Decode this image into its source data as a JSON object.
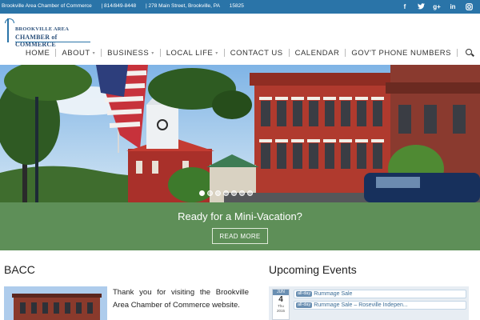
{
  "topbar": {
    "org": "Brookville Area Chamber of Commerce",
    "phone": "| 814/849-8448",
    "address": "| 278 Main Street, Brookville, PA",
    "zip": "15825",
    "social": [
      "facebook-icon",
      "twitter-icon",
      "google-plus-icon",
      "linkedin-icon",
      "instagram-icon"
    ]
  },
  "logo": {
    "line1": "BROOKVILLE AREA",
    "line2": "CHAMBER of COMMERCE"
  },
  "nav": {
    "items": [
      {
        "label": "HOME"
      },
      {
        "label": "ABOUT"
      },
      {
        "label": "BUSINESS"
      },
      {
        "label": "LOCAL LIFE"
      },
      {
        "label": "CONTACT US"
      },
      {
        "label": "CALENDAR"
      },
      {
        "label": "GOV'T PHONE NUMBERS"
      }
    ],
    "caret": "▾"
  },
  "hero": {
    "slides_count": 7,
    "active_slide": 1
  },
  "banner": {
    "title": "Ready for a Mini-Vacation?",
    "button": "READ MORE"
  },
  "bacc": {
    "title": "BACC",
    "text": "Thank you for visiting the Brookville Area Chamber of Commerce website."
  },
  "events": {
    "title": "Upcoming Events",
    "date": {
      "month": "JUN",
      "day": "4",
      "weekday": "Thu",
      "year": "2015"
    },
    "items": [
      {
        "tag": "all-day",
        "label": "Rummage Sale"
      },
      {
        "tag": "all-day",
        "label": "Rummage Sale – Roseville Indepen..."
      }
    ]
  },
  "colors": {
    "topbar": "#2a74a8",
    "banner": "#5e8f58",
    "calendar": "#e7edf3"
  }
}
